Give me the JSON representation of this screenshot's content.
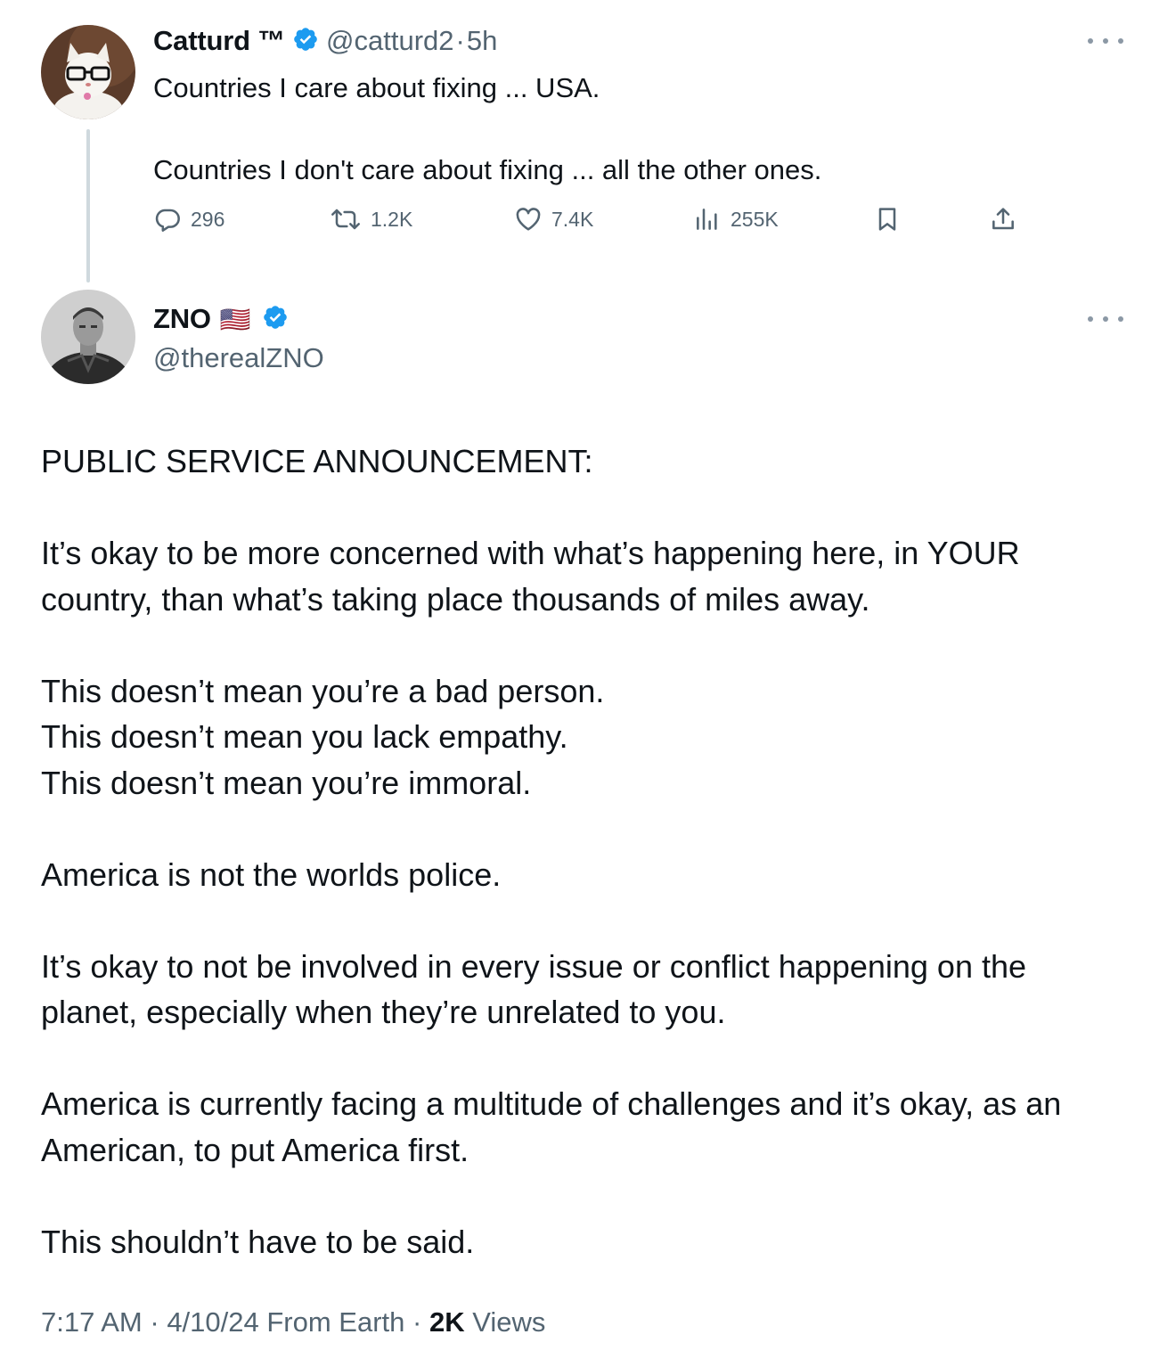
{
  "quoted_tweet": {
    "author_name": "Catturd ™",
    "handle": "@catturd2",
    "separator": "·",
    "time": "5h",
    "text": "Countries I care about fixing ... USA.\n\nCountries I don't care about fixing ... all the other ones.",
    "replies": "296",
    "retweets": "1.2K",
    "likes": "7.4K",
    "views": "255K",
    "icons": [
      "reply-icon",
      "retweet-icon",
      "like-icon",
      "views-icon",
      "bookmark-icon",
      "share-icon"
    ]
  },
  "main_tweet": {
    "author_name": "ZNO",
    "flag": "🇺🇸",
    "handle": "@therealZNO",
    "paragraphs": [
      "PUBLIC SERVICE ANNOUNCEMENT:",
      "It’s okay to be more concerned with what’s happening here, in YOUR country, than what’s taking place thousands of miles away.",
      "This doesn’t mean you’re a bad person.\nThis doesn’t mean you lack empathy.\nThis doesn’t mean you’re immoral.",
      "America is not the worlds police.",
      "It’s okay to not be involved in every issue or conflict happening on the planet, especially when they’re unrelated to you.",
      "America is currently facing a multitude of challenges and it’s okay, as an American, to put America first.",
      "This shouldn’t have to be said."
    ],
    "footer": {
      "time": "7:17 AM",
      "date": "4/10/24",
      "source": "From Earth",
      "views_count": "2K",
      "views_label": "Views"
    }
  },
  "colors": {
    "text": "#0f1419",
    "muted": "#536471",
    "verified_blue": "#1d9bf0",
    "thread_line": "#cfd9de"
  }
}
